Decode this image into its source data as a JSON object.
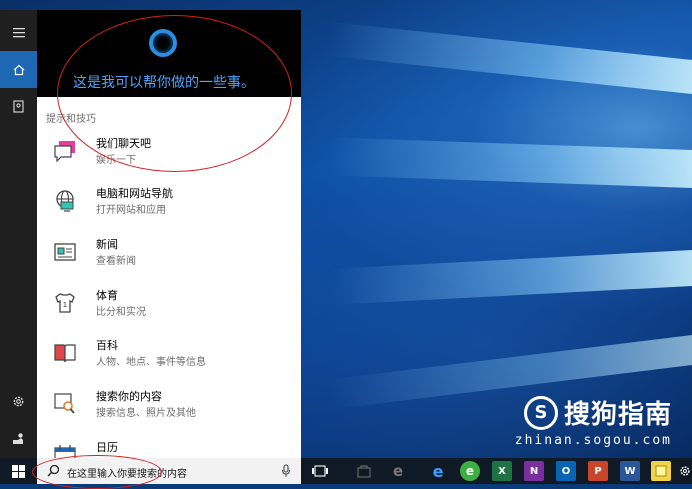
{
  "header": {
    "assistant_text": "这是我可以帮你做的一些事。"
  },
  "section": {
    "label": "提示和技巧"
  },
  "items": [
    {
      "title": "我们聊天吧",
      "subtitle": "娱乐一下",
      "icon": "chat-icon"
    },
    {
      "title": "电脑和网站导航",
      "subtitle": "打开网站和应用",
      "icon": "globe-computer-icon"
    },
    {
      "title": "新闻",
      "subtitle": "查看新闻",
      "icon": "news-icon"
    },
    {
      "title": "体育",
      "subtitle": "比分和实况",
      "icon": "jersey-icon"
    },
    {
      "title": "百科",
      "subtitle": "人物、地点、事件等信息",
      "icon": "book-icon"
    },
    {
      "title": "搜索你的内容",
      "subtitle": "搜索信息、照片及其他",
      "icon": "search-content-icon"
    },
    {
      "title": "日历",
      "subtitle": "",
      "icon": "calendar-icon"
    }
  ],
  "search": {
    "placeholder": "在这里输入你要搜索的内容"
  },
  "watermark": {
    "brand": "搜狗指南",
    "url": "zhinan.sogou.com",
    "logo_letter": "S"
  },
  "taskbar": {
    "apps": [
      {
        "name": "task-view",
        "label": ""
      },
      {
        "name": "store",
        "label": ""
      },
      {
        "name": "edge",
        "label": "e"
      },
      {
        "name": "browser-360",
        "label": "e"
      },
      {
        "name": "excel",
        "label": "X"
      },
      {
        "name": "onenote",
        "label": "N"
      },
      {
        "name": "outlook",
        "label": "O"
      },
      {
        "name": "powerpoint",
        "label": "P"
      },
      {
        "name": "word",
        "label": "W"
      },
      {
        "name": "sticky-notes",
        "label": ""
      },
      {
        "name": "settings",
        "label": ""
      }
    ]
  },
  "colors": {
    "accent": "#1d67b3",
    "cortana": "#2d8de0",
    "annotation": "#d32020"
  }
}
